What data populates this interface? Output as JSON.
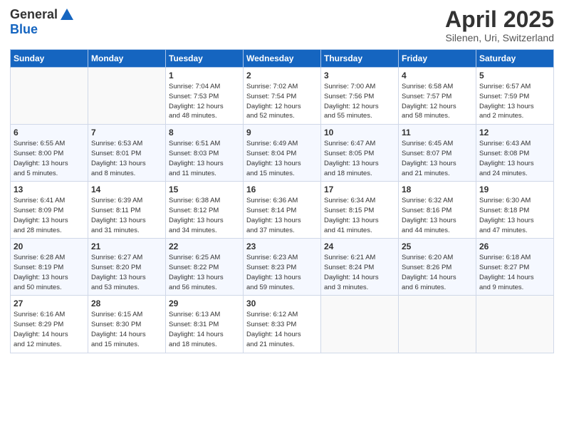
{
  "header": {
    "logo_line1": "General",
    "logo_line2": "Blue",
    "month": "April 2025",
    "location": "Silenen, Uri, Switzerland"
  },
  "weekdays": [
    "Sunday",
    "Monday",
    "Tuesday",
    "Wednesday",
    "Thursday",
    "Friday",
    "Saturday"
  ],
  "weeks": [
    [
      {
        "day": "",
        "info": ""
      },
      {
        "day": "",
        "info": ""
      },
      {
        "day": "1",
        "info": "Sunrise: 7:04 AM\nSunset: 7:53 PM\nDaylight: 12 hours\nand 48 minutes."
      },
      {
        "day": "2",
        "info": "Sunrise: 7:02 AM\nSunset: 7:54 PM\nDaylight: 12 hours\nand 52 minutes."
      },
      {
        "day": "3",
        "info": "Sunrise: 7:00 AM\nSunset: 7:56 PM\nDaylight: 12 hours\nand 55 minutes."
      },
      {
        "day": "4",
        "info": "Sunrise: 6:58 AM\nSunset: 7:57 PM\nDaylight: 12 hours\nand 58 minutes."
      },
      {
        "day": "5",
        "info": "Sunrise: 6:57 AM\nSunset: 7:59 PM\nDaylight: 13 hours\nand 2 minutes."
      }
    ],
    [
      {
        "day": "6",
        "info": "Sunrise: 6:55 AM\nSunset: 8:00 PM\nDaylight: 13 hours\nand 5 minutes."
      },
      {
        "day": "7",
        "info": "Sunrise: 6:53 AM\nSunset: 8:01 PM\nDaylight: 13 hours\nand 8 minutes."
      },
      {
        "day": "8",
        "info": "Sunrise: 6:51 AM\nSunset: 8:03 PM\nDaylight: 13 hours\nand 11 minutes."
      },
      {
        "day": "9",
        "info": "Sunrise: 6:49 AM\nSunset: 8:04 PM\nDaylight: 13 hours\nand 15 minutes."
      },
      {
        "day": "10",
        "info": "Sunrise: 6:47 AM\nSunset: 8:05 PM\nDaylight: 13 hours\nand 18 minutes."
      },
      {
        "day": "11",
        "info": "Sunrise: 6:45 AM\nSunset: 8:07 PM\nDaylight: 13 hours\nand 21 minutes."
      },
      {
        "day": "12",
        "info": "Sunrise: 6:43 AM\nSunset: 8:08 PM\nDaylight: 13 hours\nand 24 minutes."
      }
    ],
    [
      {
        "day": "13",
        "info": "Sunrise: 6:41 AM\nSunset: 8:09 PM\nDaylight: 13 hours\nand 28 minutes."
      },
      {
        "day": "14",
        "info": "Sunrise: 6:39 AM\nSunset: 8:11 PM\nDaylight: 13 hours\nand 31 minutes."
      },
      {
        "day": "15",
        "info": "Sunrise: 6:38 AM\nSunset: 8:12 PM\nDaylight: 13 hours\nand 34 minutes."
      },
      {
        "day": "16",
        "info": "Sunrise: 6:36 AM\nSunset: 8:14 PM\nDaylight: 13 hours\nand 37 minutes."
      },
      {
        "day": "17",
        "info": "Sunrise: 6:34 AM\nSunset: 8:15 PM\nDaylight: 13 hours\nand 41 minutes."
      },
      {
        "day": "18",
        "info": "Sunrise: 6:32 AM\nSunset: 8:16 PM\nDaylight: 13 hours\nand 44 minutes."
      },
      {
        "day": "19",
        "info": "Sunrise: 6:30 AM\nSunset: 8:18 PM\nDaylight: 13 hours\nand 47 minutes."
      }
    ],
    [
      {
        "day": "20",
        "info": "Sunrise: 6:28 AM\nSunset: 8:19 PM\nDaylight: 13 hours\nand 50 minutes."
      },
      {
        "day": "21",
        "info": "Sunrise: 6:27 AM\nSunset: 8:20 PM\nDaylight: 13 hours\nand 53 minutes."
      },
      {
        "day": "22",
        "info": "Sunrise: 6:25 AM\nSunset: 8:22 PM\nDaylight: 13 hours\nand 56 minutes."
      },
      {
        "day": "23",
        "info": "Sunrise: 6:23 AM\nSunset: 8:23 PM\nDaylight: 13 hours\nand 59 minutes."
      },
      {
        "day": "24",
        "info": "Sunrise: 6:21 AM\nSunset: 8:24 PM\nDaylight: 14 hours\nand 3 minutes."
      },
      {
        "day": "25",
        "info": "Sunrise: 6:20 AM\nSunset: 8:26 PM\nDaylight: 14 hours\nand 6 minutes."
      },
      {
        "day": "26",
        "info": "Sunrise: 6:18 AM\nSunset: 8:27 PM\nDaylight: 14 hours\nand 9 minutes."
      }
    ],
    [
      {
        "day": "27",
        "info": "Sunrise: 6:16 AM\nSunset: 8:29 PM\nDaylight: 14 hours\nand 12 minutes."
      },
      {
        "day": "28",
        "info": "Sunrise: 6:15 AM\nSunset: 8:30 PM\nDaylight: 14 hours\nand 15 minutes."
      },
      {
        "day": "29",
        "info": "Sunrise: 6:13 AM\nSunset: 8:31 PM\nDaylight: 14 hours\nand 18 minutes."
      },
      {
        "day": "30",
        "info": "Sunrise: 6:12 AM\nSunset: 8:33 PM\nDaylight: 14 hours\nand 21 minutes."
      },
      {
        "day": "",
        "info": ""
      },
      {
        "day": "",
        "info": ""
      },
      {
        "day": "",
        "info": ""
      }
    ]
  ]
}
